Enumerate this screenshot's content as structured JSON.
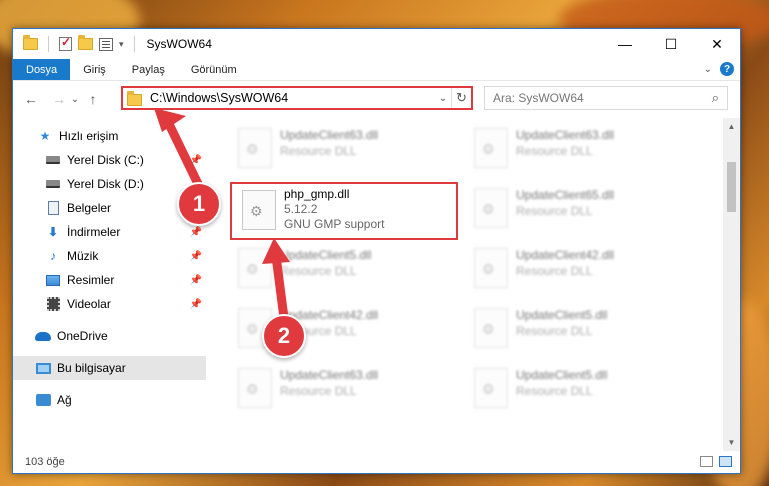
{
  "window": {
    "title": "SysWOW64",
    "controls": {
      "minimize": "—",
      "maximize": "☐",
      "close": "✕"
    }
  },
  "ribbon": {
    "tabs": [
      "Dosya",
      "Giriş",
      "Paylaş",
      "Görünüm"
    ]
  },
  "nav": {
    "back": "←",
    "forward": "→",
    "recent": "⌄",
    "up": "↑",
    "address": "C:\\Windows\\SysWOW64",
    "search_placeholder": "Ara: SysWOW64"
  },
  "sidebar": {
    "items": [
      {
        "label": "Hızlı erişim",
        "icon": "star-icon",
        "pinned": false
      },
      {
        "label": "Yerel Disk (C:)",
        "icon": "disk-icon",
        "pinned": true
      },
      {
        "label": "Yerel Disk (D:)",
        "icon": "disk-icon",
        "pinned": false
      },
      {
        "label": "Belgeler",
        "icon": "documents-icon",
        "pinned": true
      },
      {
        "label": "İndirmeler",
        "icon": "download-icon",
        "pinned": true
      },
      {
        "label": "Müzik",
        "icon": "music-icon",
        "pinned": true
      },
      {
        "label": "Resimler",
        "icon": "pictures-icon",
        "pinned": true
      },
      {
        "label": "Videolar",
        "icon": "videos-icon",
        "pinned": true
      },
      {
        "label": "OneDrive",
        "icon": "onedrive-icon",
        "pinned": false
      },
      {
        "label": "Bu bilgisayar",
        "icon": "computer-icon",
        "pinned": false
      },
      {
        "label": "Ağ",
        "icon": "network-icon",
        "pinned": false
      }
    ]
  },
  "files": [
    {
      "name": "UpdateClient63.dll",
      "line2": "Resource DLL",
      "line3": ""
    },
    {
      "name": "UpdateClient63.dll",
      "line2": "Resource DLL",
      "line3": ""
    },
    {
      "name": "php_gmp.dll",
      "line2": "5.12.2",
      "line3": "GNU GMP support"
    },
    {
      "name": "UpdateClient65.dll",
      "line2": "Resource DLL",
      "line3": ""
    },
    {
      "name": "UpdateClient5.dll",
      "line2": "Resource DLL",
      "line3": ""
    },
    {
      "name": "UpdateClient42.dll",
      "line2": "Resource DLL",
      "line3": ""
    },
    {
      "name": "UpdateClient42.dll",
      "line2": "Resource DLL",
      "line3": ""
    },
    {
      "name": "UpdateClient5.dll",
      "line2": "Resource DLL",
      "line3": ""
    },
    {
      "name": "UpdateClient63.dll",
      "line2": "Resource DLL",
      "line3": ""
    },
    {
      "name": "UpdateClient5.dll",
      "line2": "Resource DLL",
      "line3": ""
    }
  ],
  "status": {
    "count": "103 öğe"
  },
  "annotations": {
    "step1": "1",
    "step2": "2",
    "color": "#e0393e"
  }
}
